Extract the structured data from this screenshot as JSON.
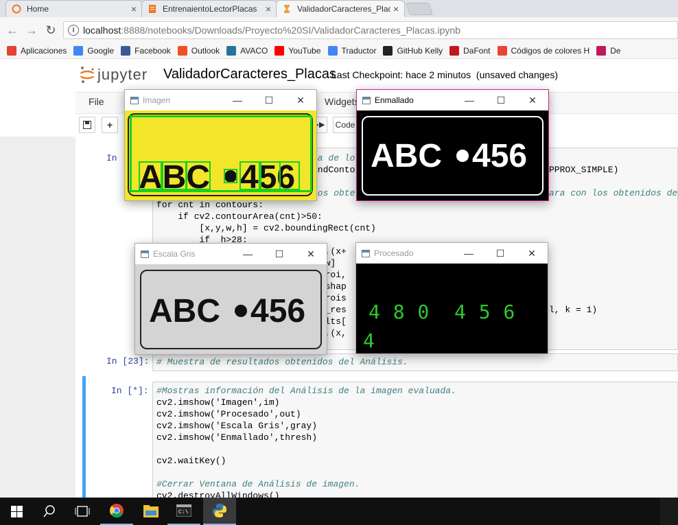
{
  "browser": {
    "tabs": [
      {
        "label": "Home",
        "icon": "jupyter-icon"
      },
      {
        "label": "EntrenaientoLectorPlacas",
        "icon": "notebook-icon"
      },
      {
        "label": "ValidadorCaracteres_Plac",
        "icon": "hourglass-icon"
      }
    ],
    "close_glyph": "×",
    "url_host": "localhost",
    "url_path": ":8888/notebooks/Downloads/Proyecto%20SI/ValidadorCaracteres_Placas.ipynb",
    "bookmarks": [
      {
        "label": "Aplicaciones",
        "color": "#e34234"
      },
      {
        "label": "Google",
        "color": "#4285f4"
      },
      {
        "label": "Facebook",
        "color": "#3b5998"
      },
      {
        "label": "Outlook",
        "color": "#f25022"
      },
      {
        "label": "AVACO",
        "color": "#21759b"
      },
      {
        "label": "YouTube",
        "color": "#ff0000"
      },
      {
        "label": "Traductor",
        "color": "#4285f4"
      },
      {
        "label": "GitHub Kelly",
        "color": "#222222"
      },
      {
        "label": "DaFont",
        "color": "#c4161c"
      },
      {
        "label": "Códigos de colores H",
        "color": "#ea4335"
      },
      {
        "label": "De",
        "color": "#c2185b"
      }
    ]
  },
  "jupyter": {
    "logo_text": "jupyter",
    "notebook_name": "ValidadorCaracteres_Placas",
    "checkpoint": "Last Checkpoint: hace 2 minutos",
    "status": "(unsaved changes)",
    "menu": {
      "file": "File",
      "widgets": "Widgets"
    },
    "toolbar": {
      "save": "💾",
      "add": "+",
      "run_all": "⏭",
      "cell_type": "Code"
    }
  },
  "cells": {
    "cell1": {
      "prompt": "In [",
      "lines": [
        "ía de lo",
        "indConto",
        "PPROX_SIMPLE)",
        "tos obte",
        "ara con los obtenidos de",
        "for cnt in contours:",
        "    if cv2.contourArea(cnt)>50:",
        "        [x,y,w,h] = cv2.boundingRect(cnt)",
        "        if  h>28:",
        "y),(x+",
        "x+w]",
        "e(roi,",
        "reshap",
        "2(rois",
        "gh_res",
        "l, k = 1)",
        "sults[",
        "ng,(x,"
      ]
    },
    "cell2": {
      "prompt": "In [23]:",
      "text": "# Muestra de resultados obtenidos del Análisis."
    },
    "cell3": {
      "prompt": "In [*]:",
      "lines": [
        "#Mostras información del Análisis de la imagen evaluada.",
        "cv2.imshow('Imagen',im)",
        "cv2.imshow('Procesado',out)",
        "cv2.imshow('Escala Gris',gray)",
        "cv2.imshow('Enmallado',thresh)",
        "",
        "cv2.waitKey()",
        "",
        "#Cerrar Ventana de Análisis de imagen.",
        "cv2.destroyAllWindows()"
      ]
    }
  },
  "windows": {
    "imagen": {
      "title": "Imagen",
      "left_text": "ABC",
      "right_text": "456",
      "plate_color": "#f2e52a",
      "box_color": "#17d11e"
    },
    "enmallado": {
      "title": "Enmallado",
      "left_text": "ABC",
      "right_text": "456"
    },
    "escala_gris": {
      "title": "Escala Gris",
      "left_text": "ABC",
      "right_text": "456"
    },
    "procesado": {
      "title": "Procesado",
      "line1": "4 8 0  4 5 6",
      "line2": "4",
      "text_color": "#2ec82e"
    },
    "controls": {
      "minimize": "—",
      "maximize": "☐",
      "close": "✕"
    }
  },
  "taskbar": {
    "items": [
      "windows-start-icon",
      "search-icon",
      "task-view-icon",
      "chrome-icon",
      "file-explorer-icon",
      "terminal-icon",
      "python-icon"
    ]
  }
}
